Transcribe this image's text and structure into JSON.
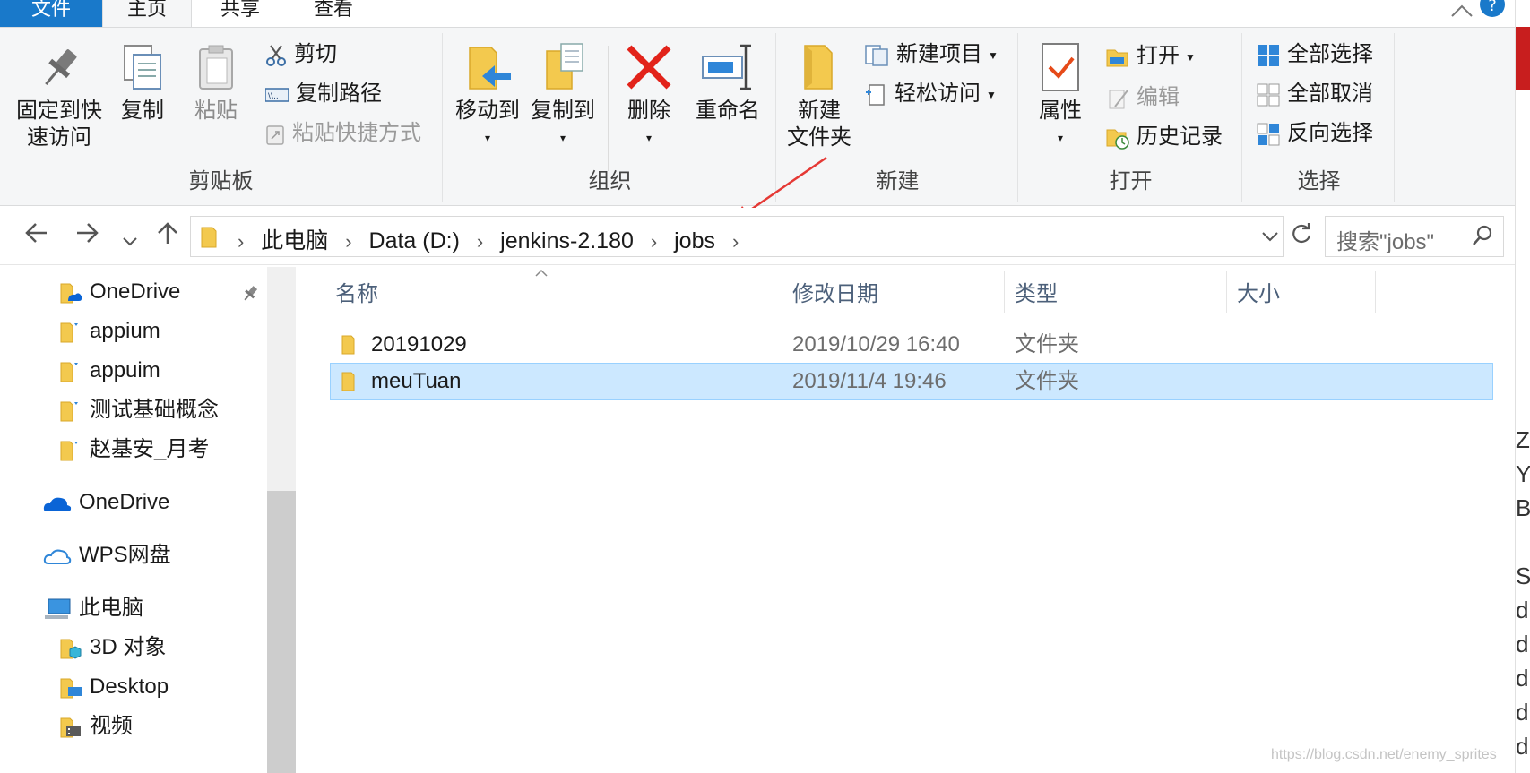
{
  "tabs": {
    "file": "文件",
    "home": "主页",
    "share": "共享",
    "view": "查看"
  },
  "ribbon": {
    "clipboard": {
      "group_label": "剪贴板",
      "pin_line1": "固定到快",
      "pin_line2": "速访问",
      "copy": "复制",
      "paste": "粘贴",
      "cut": "剪切",
      "copy_path": "复制路径",
      "paste_shortcut": "粘贴快捷方式"
    },
    "organize": {
      "group_label": "组织",
      "move_to": "移动到",
      "copy_to": "复制到",
      "delete": "删除",
      "rename": "重命名"
    },
    "new": {
      "group_label": "新建",
      "new_folder_line1": "新建",
      "new_folder_line2": "文件夹",
      "new_item": "新建项目",
      "easy_access": "轻松访问"
    },
    "open": {
      "group_label": "打开",
      "properties": "属性",
      "open": "打开",
      "edit": "编辑",
      "history": "历史记录"
    },
    "select": {
      "group_label": "选择",
      "select_all": "全部选择",
      "select_none": "全部取消",
      "invert": "反向选择"
    }
  },
  "address": {
    "crumbs": [
      "此电脑",
      "Data (D:)",
      "jenkins-2.180",
      "jobs"
    ],
    "search_placeholder": "搜索\"jobs\""
  },
  "sidebar": {
    "items": [
      {
        "label": "OneDrive",
        "icon": "onedrive-folder-icon"
      },
      {
        "label": "appium",
        "icon": "folder-icon"
      },
      {
        "label": "appuim",
        "icon": "folder-icon"
      },
      {
        "label": "测试基础概念",
        "icon": "folder-icon"
      },
      {
        "label": "赵基安_月考",
        "icon": "folder-icon"
      },
      {
        "label": "OneDrive",
        "icon": "onedrive-cloud-icon"
      },
      {
        "label": "WPS网盘",
        "icon": "wps-cloud-icon"
      },
      {
        "label": "此电脑",
        "icon": "this-pc-icon"
      },
      {
        "label": "3D 对象",
        "icon": "3d-objects-icon"
      },
      {
        "label": "Desktop",
        "icon": "desktop-folder-icon"
      },
      {
        "label": "视频",
        "icon": "video-folder-icon"
      }
    ]
  },
  "filelist": {
    "columns": [
      "名称",
      "修改日期",
      "类型",
      "大小"
    ],
    "rows": [
      {
        "name": "20191029",
        "date": "2019/10/29 16:40",
        "type": "文件夹",
        "size": ""
      },
      {
        "name": "meuTuan",
        "date": "2019/11/4 19:46",
        "type": "文件夹",
        "size": ""
      }
    ]
  },
  "edge_text": [
    "Z",
    "Y",
    "B",
    "S",
    "d",
    "d",
    "d",
    "d",
    "d"
  ],
  "watermark": "https://blog.csdn.net/enemy_sprites",
  "colors": {
    "accent": "#1979ca",
    "selection": "#cce8ff",
    "folder": "#f3c94e"
  }
}
